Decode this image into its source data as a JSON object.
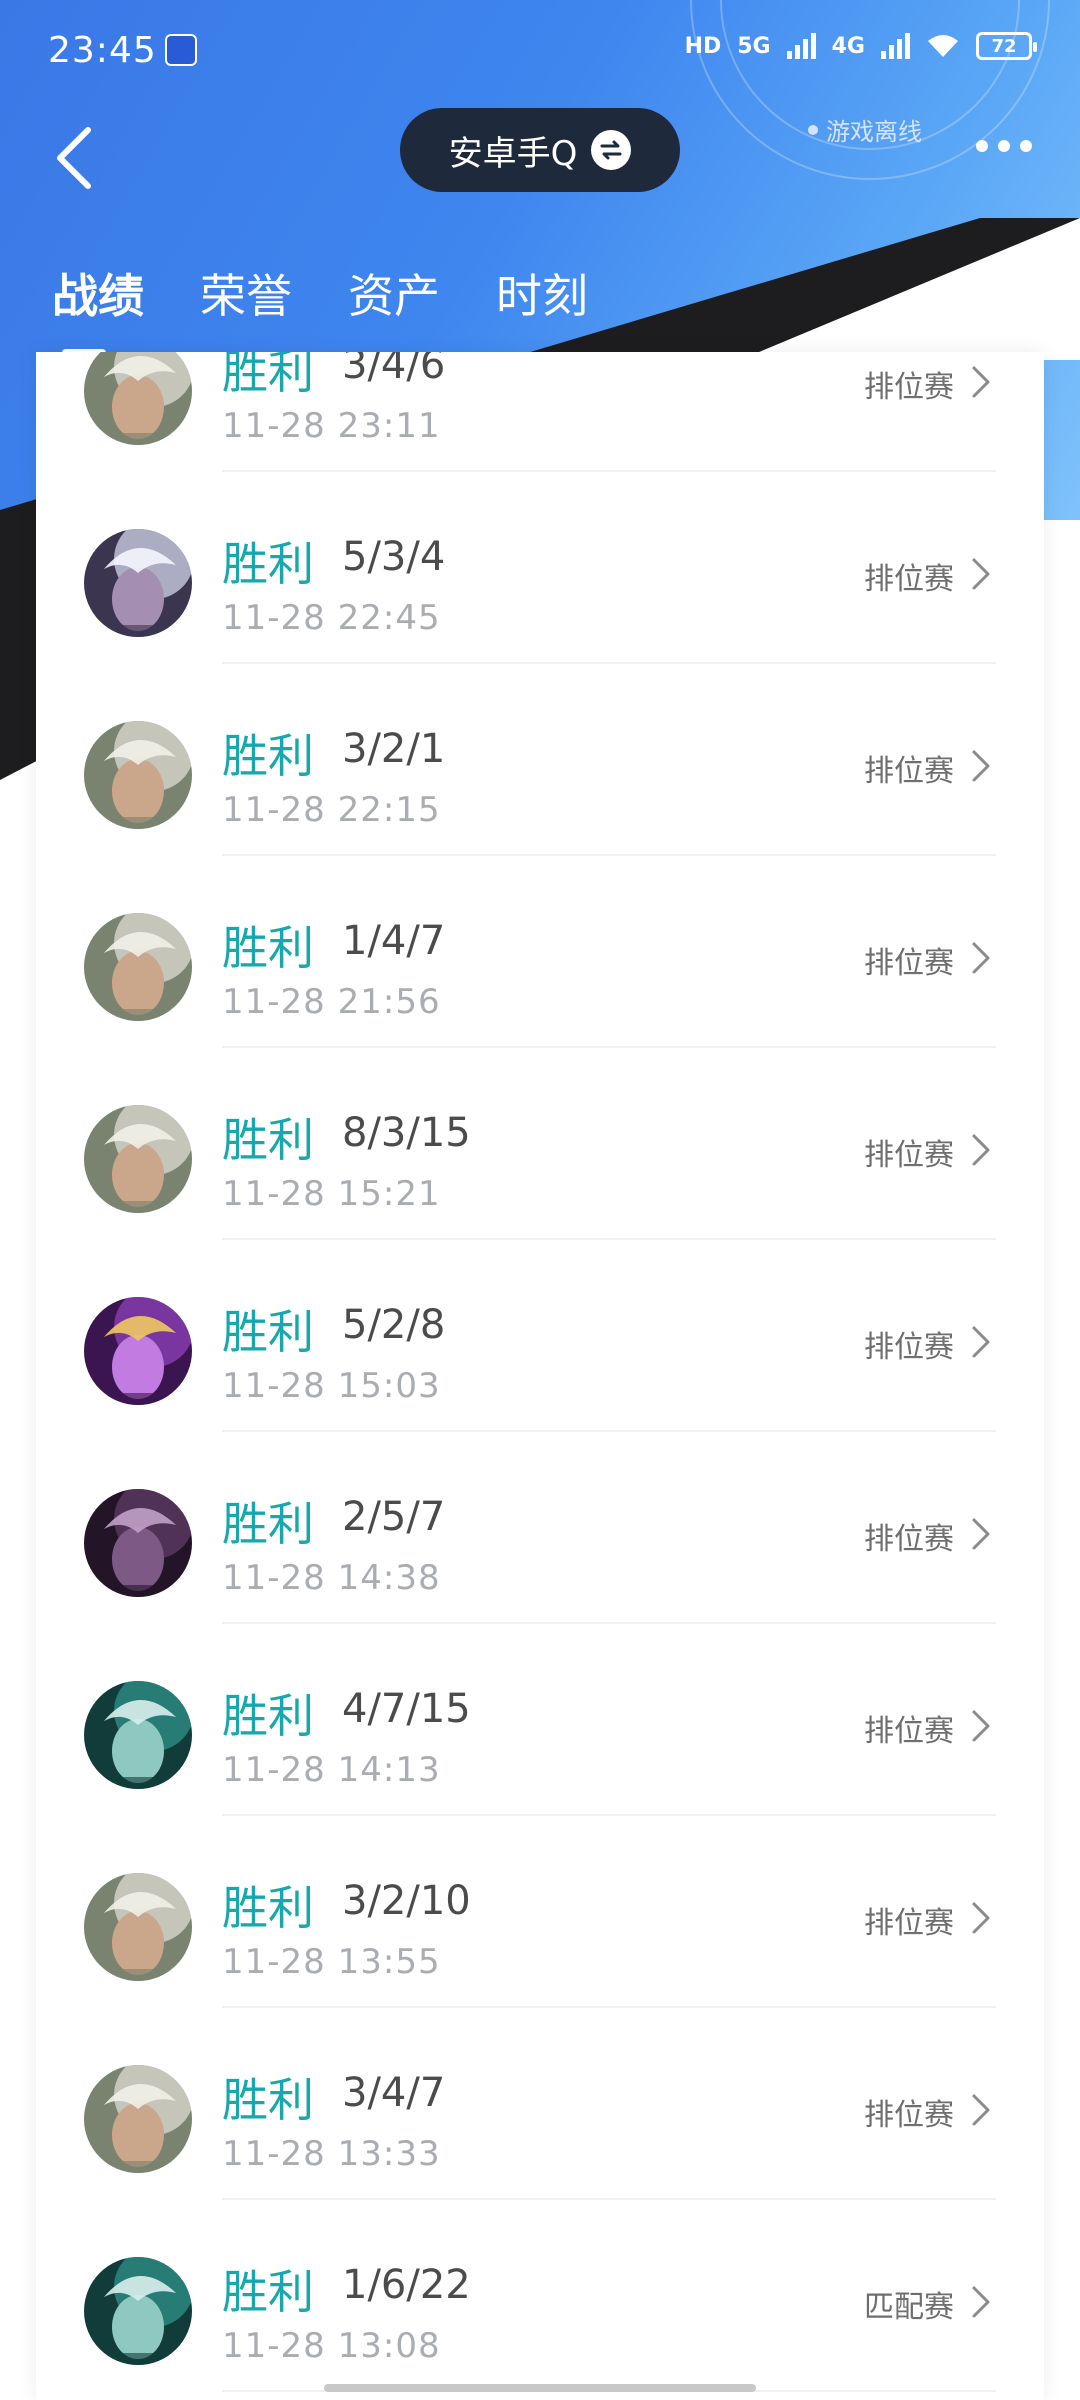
{
  "status_bar": {
    "time": "23:45",
    "hd": "HD",
    "net1": "5G",
    "net2": "4G",
    "battery": "72"
  },
  "header": {
    "account_label": "安卓手Q",
    "status_text": "游戏离线"
  },
  "tabs": [
    {
      "label": "战绩",
      "active": true
    },
    {
      "label": "荣誉",
      "active": false
    },
    {
      "label": "资产",
      "active": false
    },
    {
      "label": "时刻",
      "active": false
    }
  ],
  "matches": [
    {
      "result": "胜利",
      "kda": "3/4/6",
      "datetime": "11-28 23:11",
      "mode": "排位赛",
      "hero_icon": "hero-silver-hair-avatar"
    },
    {
      "result": "胜利",
      "kda": "5/3/4",
      "datetime": "11-28 22:45",
      "mode": "排位赛",
      "hero_icon": "hero-moon-crown-avatar"
    },
    {
      "result": "胜利",
      "kda": "3/2/1",
      "datetime": "11-28 22:15",
      "mode": "排位赛",
      "hero_icon": "hero-silver-hair-avatar"
    },
    {
      "result": "胜利",
      "kda": "1/4/7",
      "datetime": "11-28 21:56",
      "mode": "排位赛",
      "hero_icon": "hero-silver-hair-avatar"
    },
    {
      "result": "胜利",
      "kda": "8/3/15",
      "datetime": "11-28 15:21",
      "mode": "排位赛",
      "hero_icon": "hero-silver-hair-avatar"
    },
    {
      "result": "胜利",
      "kda": "5/2/8",
      "datetime": "11-28 15:03",
      "mode": "排位赛",
      "hero_icon": "hero-purple-mage-avatar"
    },
    {
      "result": "胜利",
      "kda": "2/5/7",
      "datetime": "11-28 14:38",
      "mode": "排位赛",
      "hero_icon": "hero-dark-beast-avatar"
    },
    {
      "result": "胜利",
      "kda": "4/7/15",
      "datetime": "11-28 14:13",
      "mode": "排位赛",
      "hero_icon": "hero-teal-hair-avatar"
    },
    {
      "result": "胜利",
      "kda": "3/2/10",
      "datetime": "11-28 13:55",
      "mode": "排位赛",
      "hero_icon": "hero-silver-hair-avatar"
    },
    {
      "result": "胜利",
      "kda": "3/4/7",
      "datetime": "11-28 13:33",
      "mode": "排位赛",
      "hero_icon": "hero-silver-hair-avatar"
    },
    {
      "result": "胜利",
      "kda": "1/6/22",
      "datetime": "11-28 13:08",
      "mode": "匹配赛",
      "hero_icon": "hero-teal-hair-avatar"
    }
  ],
  "colors": {
    "result_win": "#17a7ac",
    "header_blue": "#3f86ef",
    "header_dark": "#1d1d1f"
  }
}
